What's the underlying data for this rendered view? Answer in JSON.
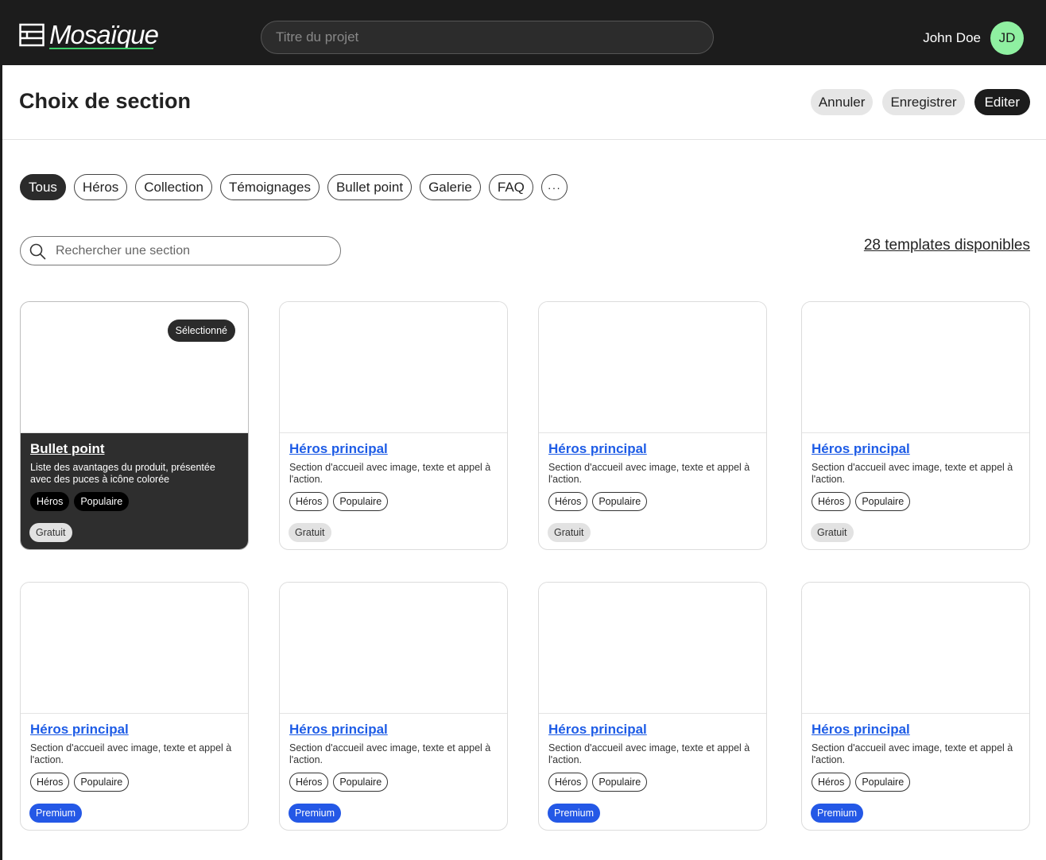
{
  "app": {
    "logo_text": "Mosaïque",
    "project_placeholder": "Titre du projet",
    "user_name": "John Doe",
    "avatar_initials": "JD",
    "accent_color": "#8ff0a1"
  },
  "header": {
    "title": "Choix de section",
    "cancel_label": "Annuler",
    "save_label": "Enregistrer",
    "edit_label": "Editer"
  },
  "filters": [
    "Tous",
    "Héros",
    "Collection",
    "Témoignages",
    "Bullet point",
    "Galerie",
    "FAQ",
    "···"
  ],
  "active_filter": "Tous",
  "search": {
    "placeholder": "Rechercher une section",
    "count_label": "28 templates disponibles"
  },
  "cards": [
    {
      "title": "Bullet point",
      "desc": "Liste des avantages du produit, présentée avec des puces à icône colorée",
      "tags": [
        "Héros",
        "Populaire"
      ],
      "price": "Gratuit",
      "selected": true,
      "badge": "Sélectionné"
    },
    {
      "title": "Héros principal",
      "desc": "Section d'accueil avec image, texte et appel à l'action.",
      "tags": [
        "Héros",
        "Populaire"
      ],
      "price": "Gratuit",
      "selected": false
    },
    {
      "title": "Héros principal",
      "desc": "Section d'accueil avec image, texte et appel à l'action.",
      "tags": [
        "Héros",
        "Populaire"
      ],
      "price": "Gratuit",
      "selected": false
    },
    {
      "title": "Héros principal",
      "desc": "Section d'accueil avec image, texte et appel à l'action.",
      "tags": [
        "Héros",
        "Populaire"
      ],
      "price": "Gratuit",
      "selected": false
    },
    {
      "title": "Héros principal",
      "desc": "Section d'accueil avec image, texte et appel à l'action.",
      "tags": [
        "Héros",
        "Populaire"
      ],
      "price": "Premium",
      "selected": false
    },
    {
      "title": "Héros principal",
      "desc": "Section d'accueil avec image, texte et appel à l'action.",
      "tags": [
        "Héros",
        "Populaire"
      ],
      "price": "Premium",
      "selected": false
    },
    {
      "title": "Héros principal",
      "desc": "Section d'accueil avec image, texte et appel à l'action.",
      "tags": [
        "Héros",
        "Populaire"
      ],
      "price": "Premium",
      "selected": false
    },
    {
      "title": "Héros principal",
      "desc": "Section d'accueil avec image, texte et appel à l'action.",
      "tags": [
        "Héros",
        "Populaire"
      ],
      "price": "Premium",
      "selected": false
    }
  ],
  "colors": {
    "premium": "#2458e6",
    "link": "#1e5ce6",
    "dark": "#1c1c1c"
  }
}
